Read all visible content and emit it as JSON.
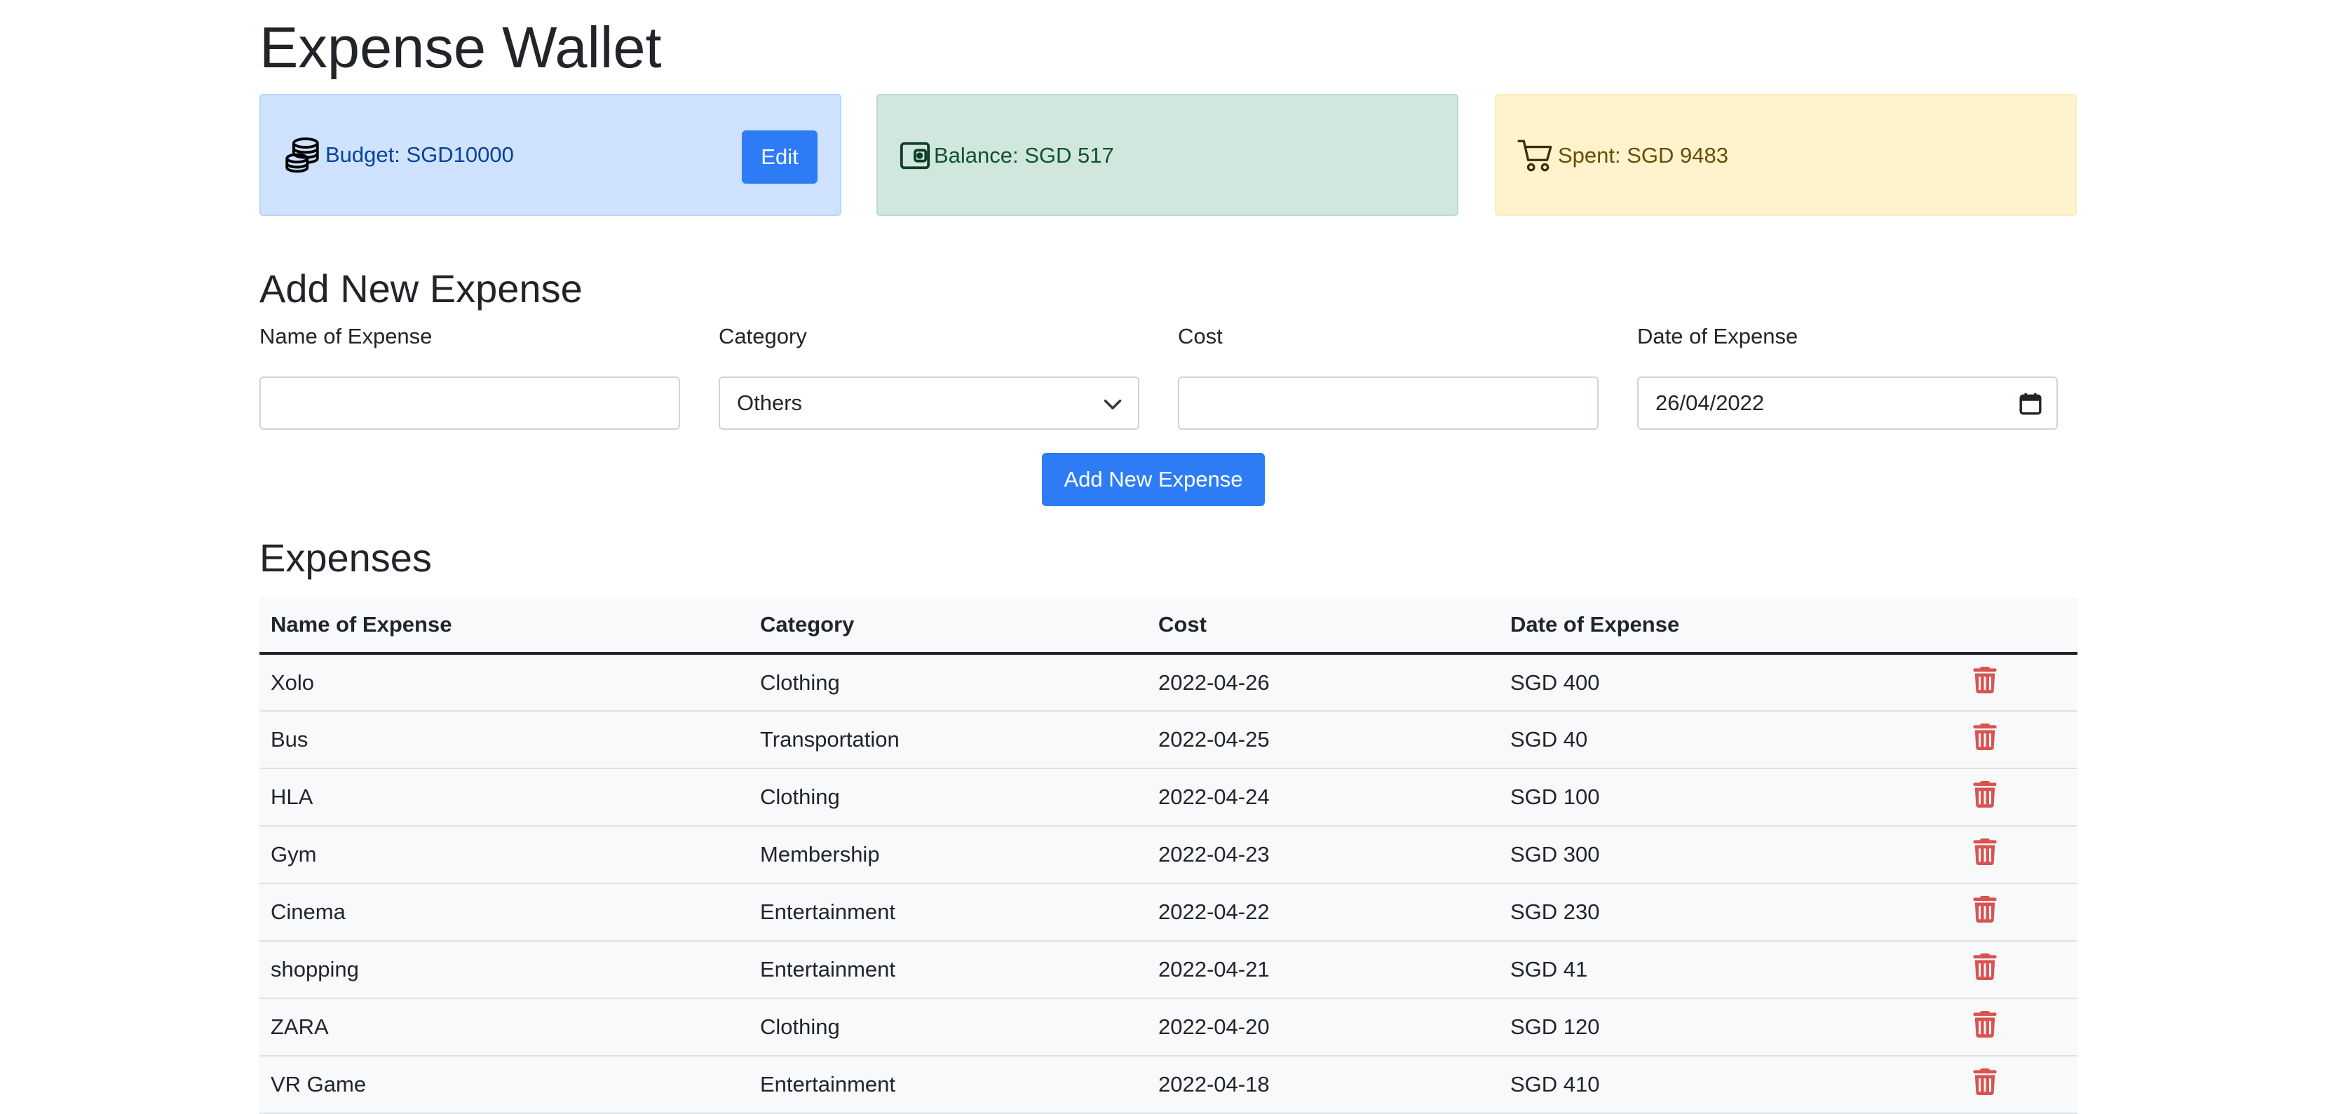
{
  "app": {
    "title": "Expense Wallet"
  },
  "cards": {
    "budget": {
      "text": "Budget: SGD10000",
      "edit_label": "Edit",
      "icon": "coins-icon"
    },
    "balance": {
      "text": "Balance: SGD 517",
      "icon": "wallet-icon"
    },
    "spent": {
      "text": "Spent: SGD 9483",
      "icon": "cart-icon"
    }
  },
  "form": {
    "title": "Add New Expense",
    "name_label": "Name of Expense",
    "name_value": "",
    "category_label": "Category",
    "category_value": "Others",
    "cost_label": "Cost",
    "cost_value": "",
    "date_label": "Date of Expense",
    "date_value": "26/04/2022",
    "submit_label": "Add New Expense"
  },
  "expenses": {
    "title": "Expenses",
    "headers": [
      "Name of Expense",
      "Category",
      "Cost",
      "Date of Expense"
    ],
    "rows": [
      {
        "name": "Xolo",
        "category": "Clothing",
        "cost": "2022-04-26",
        "date": "SGD 400"
      },
      {
        "name": "Bus",
        "category": "Transportation",
        "cost": "2022-04-25",
        "date": "SGD 40"
      },
      {
        "name": "HLA",
        "category": "Clothing",
        "cost": "2022-04-24",
        "date": "SGD 100"
      },
      {
        "name": "Gym",
        "category": "Membership",
        "cost": "2022-04-23",
        "date": "SGD 300"
      },
      {
        "name": "Cinema",
        "category": "Entertainment",
        "cost": "2022-04-22",
        "date": "SGD 230"
      },
      {
        "name": "shopping",
        "category": "Entertainment",
        "cost": "2022-04-21",
        "date": "SGD 41"
      },
      {
        "name": "ZARA",
        "category": "Clothing",
        "cost": "2022-04-20",
        "date": "SGD 120"
      },
      {
        "name": "VR Game",
        "category": "Entertainment",
        "cost": "2022-04-18",
        "date": "SGD 410"
      }
    ]
  },
  "colors": {
    "primary": "#2d7cf6",
    "budget_bg": "#cfe2ff",
    "balance_bg": "#d1e7dd",
    "spent_bg": "#fff3cd",
    "delete": "#d9534f"
  }
}
